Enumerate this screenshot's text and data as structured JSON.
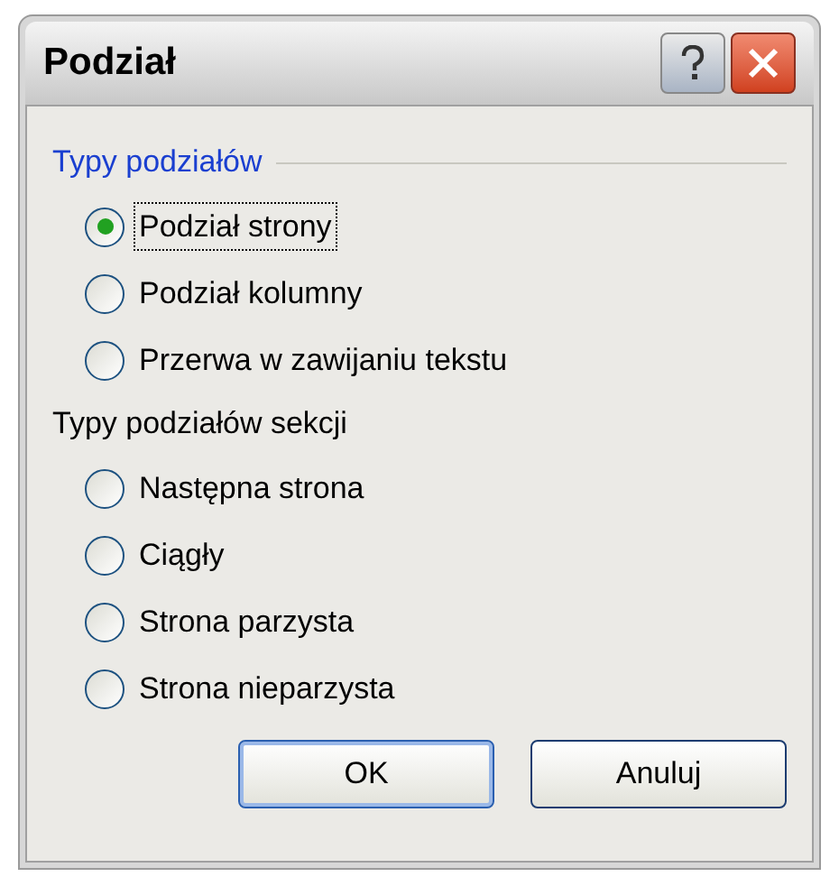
{
  "window": {
    "title": "Podział"
  },
  "groups": [
    {
      "heading": "Typy podziałów",
      "kind": "framed",
      "options": [
        {
          "label": "Podział strony",
          "selected": true,
          "focused": true
        },
        {
          "label": "Podział kolumny",
          "selected": false,
          "focused": false
        },
        {
          "label": "Przerwa w zawijaniu tekstu",
          "selected": false,
          "focused": false
        }
      ]
    },
    {
      "heading": "Typy podziałów sekcji",
      "kind": "plain",
      "options": [
        {
          "label": "Następna strona",
          "selected": false,
          "focused": false
        },
        {
          "label": "Ciągły",
          "selected": false,
          "focused": false
        },
        {
          "label": "Strona parzysta",
          "selected": false,
          "focused": false
        },
        {
          "label": "Strona nieparzysta",
          "selected": false,
          "focused": false
        }
      ]
    }
  ],
  "buttons": [
    {
      "label": "OK",
      "default": true
    },
    {
      "label": "Anuluj",
      "default": false
    }
  ]
}
